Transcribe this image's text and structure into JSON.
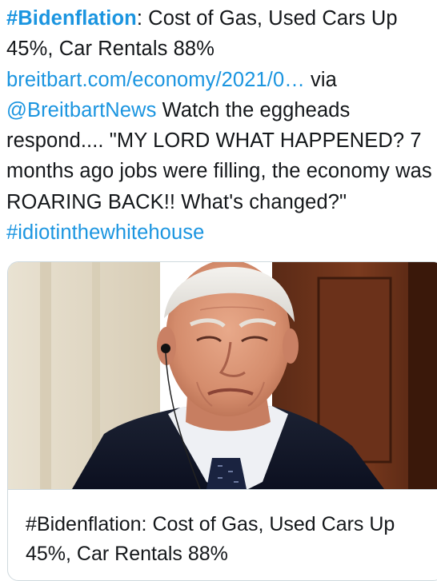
{
  "tweet": {
    "hashtag_bidenflation": "#Bidenflation",
    "headline_text": ": Cost of Gas, Used Cars Up 45%, Car Rentals 88% ",
    "link_url": "breitbart.com/economy/2021/0…",
    "via_text": " via ",
    "mention": "@BreitbartNews",
    "comment_text": " Watch the eggheads respond.... \"MY LORD WHAT HAPPENED? 7 months ago jobs were filling, the economy was ROARING BACK!! What's changed?\" ",
    "hashtag_end": "#idiotinthewhitehouse"
  },
  "card": {
    "title": "#Bidenflation: Cost of Gas, Used Cars Up 45%, Car Rentals 88%"
  },
  "colors": {
    "link": "#1b95e0",
    "text": "#14171a",
    "border": "#cfd9de"
  }
}
